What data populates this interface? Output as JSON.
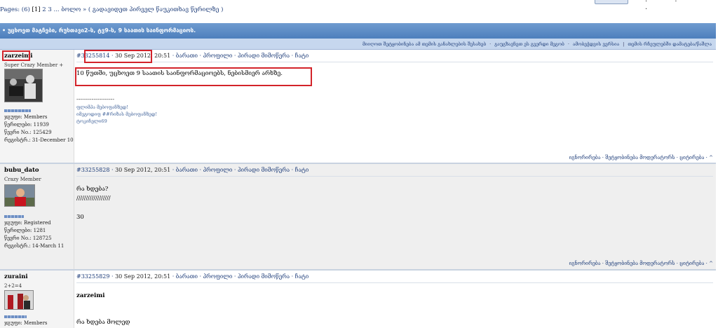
{
  "pagination": {
    "label": "Pages: (6) ",
    "current": "[1]",
    "pages": " 2 3 ... ",
    "last": "ბოლო »",
    "jump": "( გადავიდეთ პირველ წაუკითხავ წერილზე )"
  },
  "topic": {
    "title": "• უცხოეთ მატჩები, რუსთავი2-ს, ტვ9-ს, 9 საათის საინფორმაციოს."
  },
  "topic_links": [
    "მიიღოთ შეტყობინება ამ თემის განახლების შესახებ",
    "გაუგზავნეთ ეს გვერდი მეგობ",
    "ამობეჭდვის ვერსია",
    "თემის რჩეულებში დამატება/წაშლა"
  ],
  "posts": [
    {
      "author": "zarzeimi",
      "rank": "Super Crazy Member +",
      "stats": [
        "ჯგუფი: Members",
        "წერილები: 11939",
        "წევრი No.: 125429",
        "რეგისტრ.: 31-December 10"
      ],
      "post_num": "#33255814",
      "date": "30 Sep 2012, 20:51",
      "actions": " · ბარათი · პროფილი · პირადი მიმოწერა · ჩატი",
      "body": [
        "10 წუთში, უცხოეთ 9 საათის საინფორმაციოებს, ნებისმიერ არხზე."
      ],
      "sig_separator": "--------------------",
      "signature": [
        "ფლიმპა მებოფანზედ!",
        "იმეგოდიფ ##რიზას მებოფანზედ!",
        "ტოკიჩელი69"
      ],
      "footer": "იგნორირება · შეტყობინება მოდერატორს · ციტირება · ^"
    },
    {
      "author": "bubu_dato",
      "rank": "Crazy Member",
      "stats": [
        "ჯგუფი: Registered",
        "წერილები: 1281",
        "წევრი No.: 128725",
        "რეგისტრ.: 14-March 11"
      ],
      "post_num": "#33255828",
      "date": "30 Sep 2012, 20:51",
      "actions": " · ბარათი · პროფილი · პირადი მიმოწერა · ჩატი",
      "body": [
        "რა ხდება?",
        "//////////////////",
        "30"
      ],
      "footer": "იგნორირება · შეტყობინება მოდერატორს · ციტირება · ^"
    },
    {
      "author": "zuraini",
      "rank": "2+2=4",
      "stats": [
        "ჯგუფი: Members"
      ],
      "post_num": "#33255829",
      "date": "30 Sep 2012, 20:51",
      "actions": " · ბარათი · პროფილი · პირადი მიმოწერა · ჩატი",
      "quote_author": "zarzeimi",
      "body": [
        "რა ხდება მოლედ"
      ]
    }
  ],
  "colors": {
    "titlebar": "#5a8ac6",
    "subbar": "#c6d7ee",
    "link": "#1f3e7a",
    "highlight": "#d3232a"
  }
}
